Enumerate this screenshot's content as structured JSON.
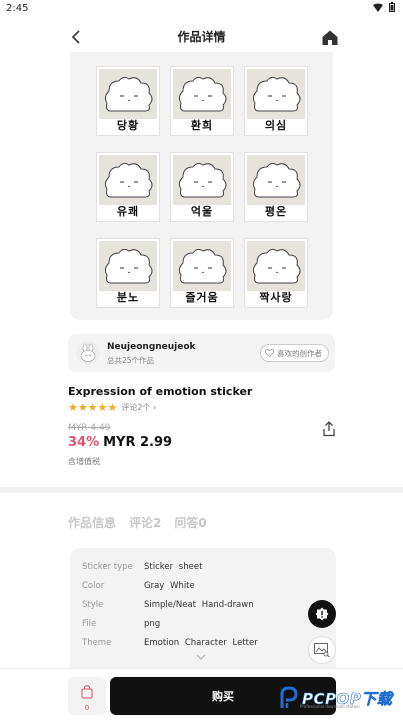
{
  "status": {
    "time": "2:45"
  },
  "header": {
    "title": "作品详情"
  },
  "stickers": [
    {
      "label": "당황"
    },
    {
      "label": "환희"
    },
    {
      "label": "의심"
    },
    {
      "label": "유쾌"
    },
    {
      "label": "억울"
    },
    {
      "label": "평온"
    },
    {
      "label": "분노"
    },
    {
      "label": "즐거움"
    },
    {
      "label": "짝사랑"
    }
  ],
  "creator": {
    "name": "Neujeongneujeok",
    "count": "总共25个作品",
    "follow_label": "喜欢的创作者"
  },
  "product": {
    "title": "Expression of emotion sticker",
    "rating": 5,
    "reviews_link": "评论2个",
    "price_old": "MYR 4.49",
    "discount": "34%",
    "price": "MYR 2.99",
    "tax_note": "含增值税"
  },
  "tabs": [
    {
      "label": "作品信息"
    },
    {
      "label": "评论2"
    },
    {
      "label": "问答0"
    }
  ],
  "info": [
    {
      "key": "Sticker type",
      "value": "Sticker sheet"
    },
    {
      "key": "Color",
      "value": "Gray  White"
    },
    {
      "key": "Style",
      "value": "Simple/Neat  Hand-drawn"
    },
    {
      "key": "File",
      "value": "png"
    },
    {
      "key": "Theme",
      "value": "Emotion  Character  Letter"
    }
  ],
  "bottom": {
    "cart_count": "0",
    "buy_label": "购买"
  },
  "watermark": {
    "text": "PCPOP下载",
    "sub": "Professional download station"
  },
  "colors": {
    "accent": "#e5506a",
    "star": "#f2a91f",
    "buy": "#111111"
  }
}
